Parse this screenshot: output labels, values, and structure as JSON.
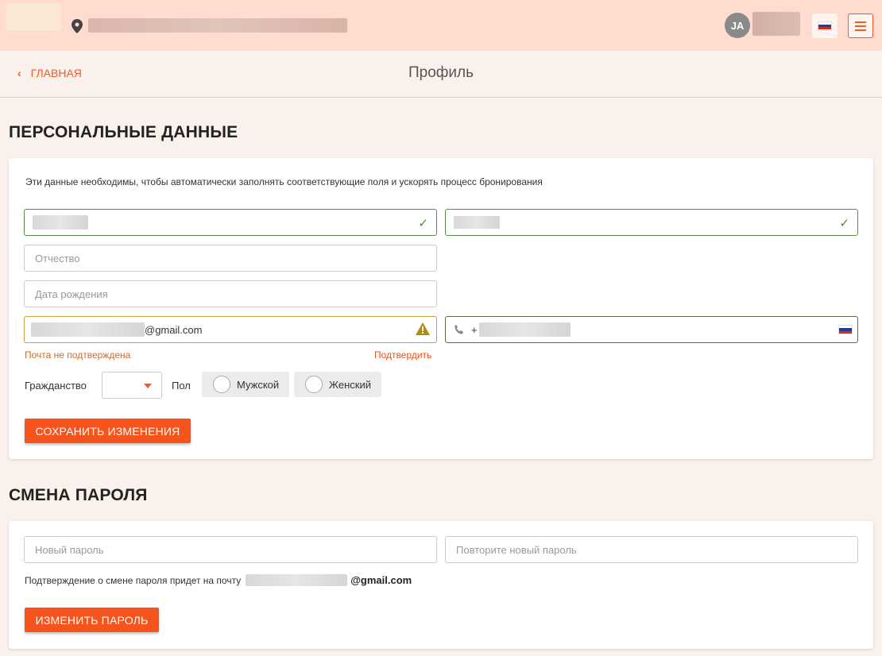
{
  "header": {
    "avatar_initials": "JA",
    "flag_icon": "russia-flag-icon",
    "menu_icon": "hamburger-menu-icon",
    "location_icon": "map-pin-icon"
  },
  "nav": {
    "back_label": "ГЛАВНАЯ",
    "title": "Профиль"
  },
  "personal": {
    "heading": "ПЕРСОНАЛЬНЫЕ ДАННЫЕ",
    "description": "Эти данные необходимы, чтобы автоматически заполнять соответствующие поля и ускорять процесс бронирования",
    "patronymic_placeholder": "Отчество",
    "birthdate_placeholder": "Дата рождения",
    "email_suffix": "@gmail.com",
    "phone_prefix": "+",
    "email_status": "Почта не подтверждена",
    "confirm_link": "Подтвердить",
    "citizenship_label": "Гражданство",
    "gender_label": "Пол",
    "gender_male": "Мужской",
    "gender_female": "Женский",
    "save_button": "СОХРАНИТЬ ИЗМЕНЕНИЯ"
  },
  "password": {
    "heading": "СМЕНА ПАРОЛЯ",
    "new_placeholder": "Новый пароль",
    "repeat_placeholder": "Повторите новый пароль",
    "note": "Подтверждение о смене пароля придет на почту",
    "email_suffix": "@gmail.com",
    "change_button": "ИЗМЕНИТЬ ПАРОЛЬ"
  },
  "colors": {
    "accent": "#f6531d",
    "header_bg": "#ffdccf",
    "page_bg": "#fbf1ec",
    "ok_border": "#5a8a4a",
    "warn_border": "#c9a23a"
  }
}
